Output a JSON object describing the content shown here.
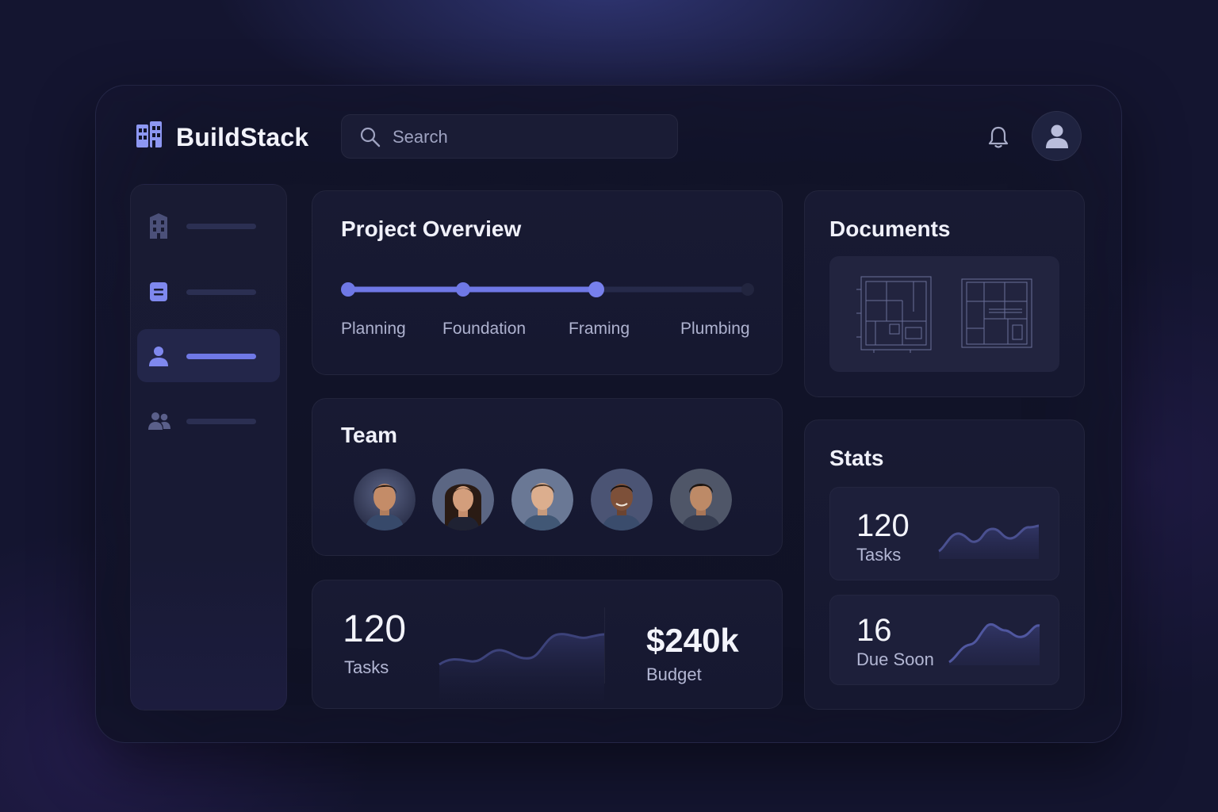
{
  "app": {
    "name": "BuildStack",
    "logo_icon": "building-icon",
    "accent_color": "#6f78e6"
  },
  "search": {
    "placeholder": "Search",
    "value": ""
  },
  "header": {
    "notification_icon": "bell-icon",
    "avatar_icon": "user-icon"
  },
  "sidebar": {
    "items": [
      {
        "icon": "building-icon",
        "label": "",
        "active": false
      },
      {
        "icon": "document-icon",
        "label": "",
        "active": false
      },
      {
        "icon": "user-icon",
        "label": "",
        "active": true
      },
      {
        "icon": "group-icon",
        "label": "",
        "active": false
      }
    ]
  },
  "project_overview": {
    "title": "Project Overview",
    "stages": [
      "Planning",
      "Foundation",
      "Framing",
      "Plumbing"
    ],
    "completed_stage_count": 3
  },
  "team": {
    "title": "Team",
    "members": [
      {
        "avatar": "member-avatar-1"
      },
      {
        "avatar": "member-avatar-2"
      },
      {
        "avatar": "member-avatar-3"
      },
      {
        "avatar": "member-avatar-4"
      },
      {
        "avatar": "member-avatar-5"
      }
    ]
  },
  "summary": {
    "tasks_value": "120",
    "tasks_label": "Tasks",
    "budget_value": "$240k",
    "budget_label": "Budget"
  },
  "documents": {
    "title": "Documents",
    "items": [
      {
        "icon": "blueprint-icon"
      },
      {
        "icon": "blueprint-icon"
      }
    ]
  },
  "stats": {
    "title": "Stats",
    "items": [
      {
        "value": "120",
        "label": "Tasks"
      },
      {
        "value": "16",
        "label": "Due Soon"
      }
    ]
  }
}
